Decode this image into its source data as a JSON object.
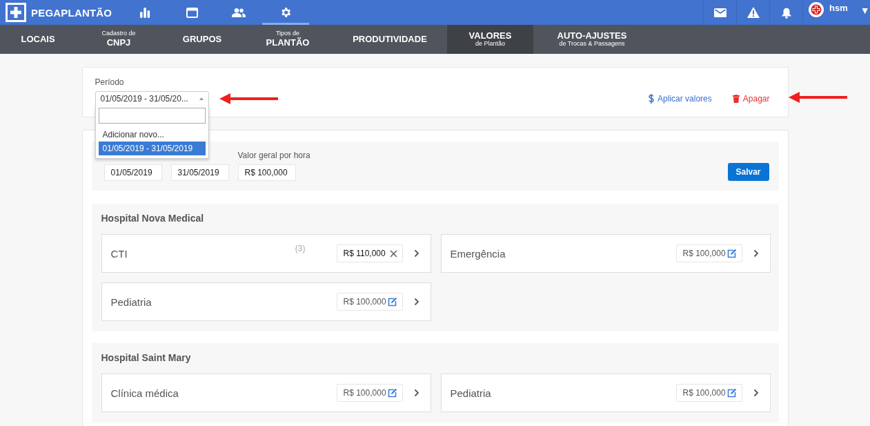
{
  "app": {
    "logo": "PEGAPLANTÃO"
  },
  "top_nav": [
    {
      "kind": "chart",
      "selected": false
    },
    {
      "kind": "window",
      "selected": false
    },
    {
      "kind": "people",
      "selected": false
    },
    {
      "kind": "gear",
      "selected": true
    }
  ],
  "top_right": {
    "user": "hsm",
    "caret": "▼"
  },
  "sub_nav": [
    {
      "label": "LOCAIS",
      "selected": false
    },
    {
      "kicker": "Cadastro de",
      "label": "CNPJ",
      "selected": false
    },
    {
      "label": "GRUPOS",
      "selected": false
    },
    {
      "kicker": "Tipos de",
      "label": "PLANTÃO",
      "selected": false
    },
    {
      "label": "PRODUTIVIDADE",
      "selected": false
    },
    {
      "label": "VALORES",
      "caption": "de Plantão",
      "selected": true
    },
    {
      "label": "AUTO-AJUSTES",
      "caption": "de Trocas & Passagens",
      "selected": false
    }
  ],
  "period": {
    "label": "Período",
    "value": "01/05/2019 - 31/05/20...",
    "expanded": true,
    "options": [
      {
        "label": "Adicionar novo...",
        "selected": false
      },
      {
        "label": "01/05/2019 - 31/05/2019",
        "selected": true
      }
    ]
  },
  "actions": [
    {
      "kind": "apply",
      "label": "Aplicar valores"
    },
    {
      "kind": "delete",
      "label": "Apagar"
    }
  ],
  "general": {
    "fields": [
      {
        "value": "01/05/2019"
      },
      {
        "value": "31/05/2019"
      },
      {
        "label": "Valor geral por hora",
        "value": "R$ 100,000"
      }
    ],
    "save": "Salvar"
  },
  "hospitals": [
    {
      "name": "Hospital Nova Medical",
      "units": [
        {
          "name": "CTI",
          "count": "(3)",
          "value": "R$ 110,000",
          "editing": true
        },
        {
          "name": "Emergência",
          "value": "R$ 100,000",
          "editing": false
        },
        {
          "name": "Pediatria",
          "value": "R$ 100,000",
          "editing": false
        }
      ]
    },
    {
      "name": "Hospital Saint Mary",
      "units": [
        {
          "name": "Clínica médica",
          "value": "R$ 100,000",
          "editing": false
        },
        {
          "name": "Pediatria",
          "value": "R$ 100,000",
          "editing": false
        }
      ]
    }
  ]
}
